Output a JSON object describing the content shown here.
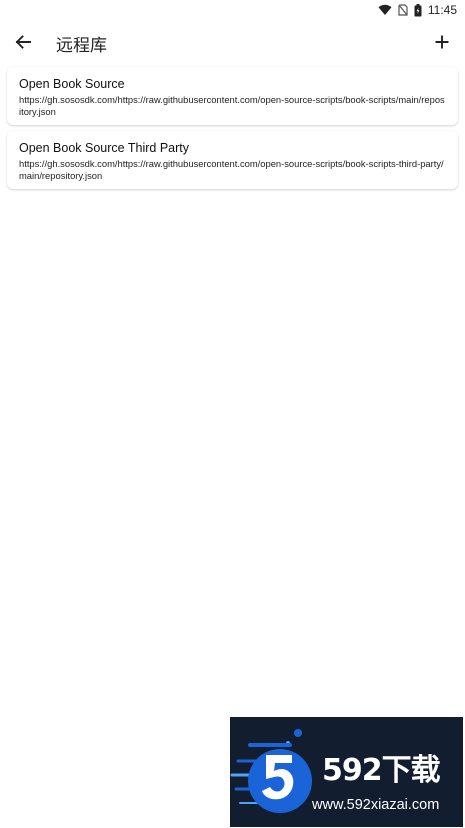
{
  "status_bar": {
    "time": "11:45",
    "icons": [
      "wifi-icon",
      "sim-off-icon",
      "battery-charging-icon"
    ]
  },
  "app_bar": {
    "title": "远程库",
    "back_icon": "arrow-left-icon",
    "add_icon": "plus-icon"
  },
  "repositories": [
    {
      "name": "Open Book Source",
      "url": "https://gh.sososdk.com/https://raw.githubusercontent.com/open-source-scripts/book-scripts/main/repository.json"
    },
    {
      "name": "Open Book Source Third Party",
      "url": "https://gh.sososdk.com/https://raw.githubusercontent.com/open-source-scripts/book-scripts-third-party/main/repository.json"
    }
  ],
  "watermark": {
    "brand": "592下载",
    "url": "www.592xiazai.com",
    "background": "#121d30",
    "accent": "#1b64d8"
  }
}
